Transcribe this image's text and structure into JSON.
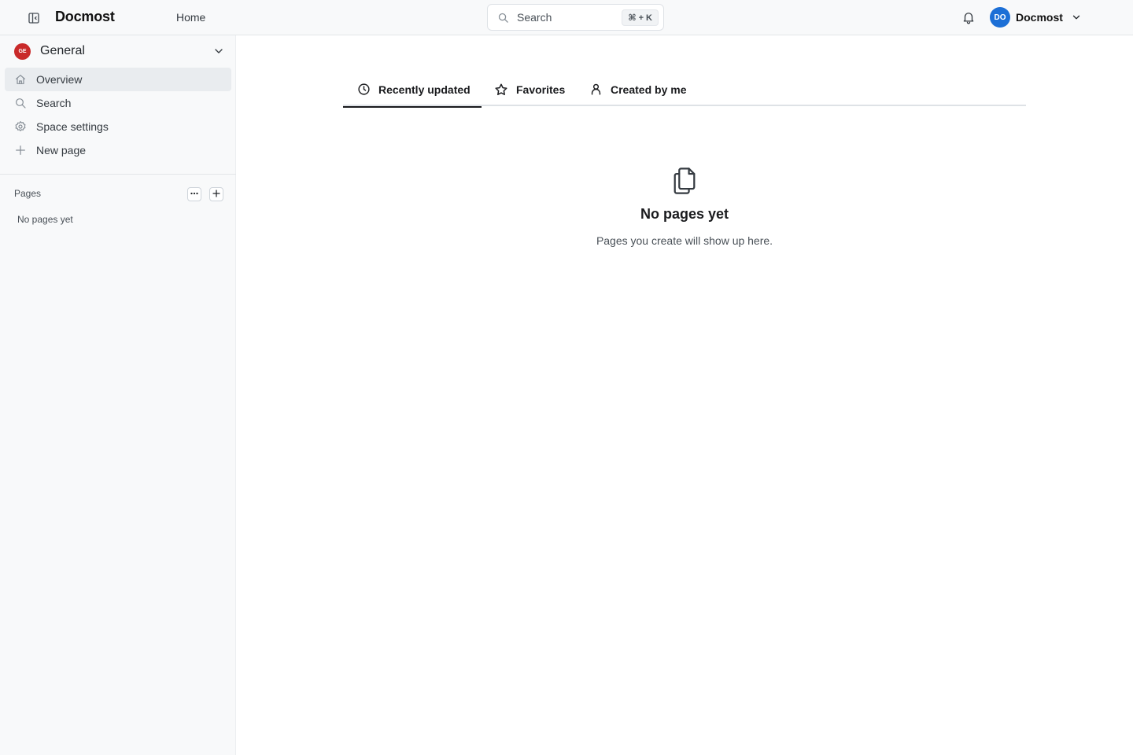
{
  "header": {
    "brand": "Docmost",
    "home_label": "Home",
    "search_placeholder": "Search",
    "search_shortcut": "⌘ + K",
    "user_initials": "DO",
    "user_name": "Docmost"
  },
  "sidebar": {
    "space_initials": "GE",
    "space_name": "General",
    "items": [
      {
        "label": "Overview",
        "icon": "home-icon",
        "active": true
      },
      {
        "label": "Search",
        "icon": "search-icon",
        "active": false
      },
      {
        "label": "Space settings",
        "icon": "gear-icon",
        "active": false
      },
      {
        "label": "New page",
        "icon": "plus-icon",
        "active": false
      }
    ],
    "pages_label": "Pages",
    "pages_empty": "No pages yet"
  },
  "tabs": [
    {
      "label": "Recently updated",
      "icon": "clock-icon",
      "active": true
    },
    {
      "label": "Favorites",
      "icon": "star-icon",
      "active": false
    },
    {
      "label": "Created by me",
      "icon": "user-icon",
      "active": false
    }
  ],
  "empty_state": {
    "icon": "files-icon",
    "title": "No pages yet",
    "description": "Pages you create will show up here."
  },
  "colors": {
    "user_avatar": "#1c6fd6",
    "space_avatar": "#c92a2a",
    "active_nav_bg": "#e9ecef"
  }
}
